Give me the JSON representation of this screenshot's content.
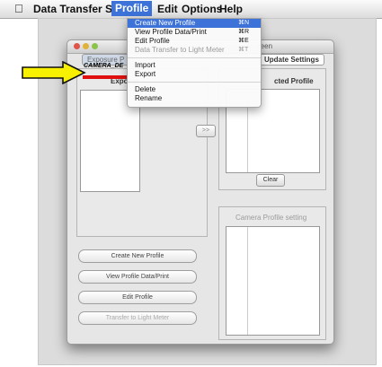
{
  "menubar": {
    "apple_icon": "apple-logo",
    "app_name": "Data Transfer Software",
    "menus": [
      "Profile",
      "Edit",
      "Options",
      "Help"
    ]
  },
  "dropdown": {
    "items": [
      {
        "label": "Create New Profile",
        "shortcut": "⌘N"
      },
      {
        "label": "View Profile Data/Print",
        "shortcut": "⌘R"
      },
      {
        "label": "Edit Profile",
        "shortcut": "⌘E"
      },
      {
        "label": "Data Transfer to Light Meter",
        "shortcut": "⌘T"
      },
      {
        "label": "Import",
        "shortcut": ""
      },
      {
        "label": "Export",
        "shortcut": ""
      },
      {
        "label": "Delete",
        "shortcut": ""
      },
      {
        "label": "Rename",
        "shortcut": ""
      }
    ]
  },
  "window": {
    "title_fragment": "reen",
    "tabs": [
      "Exposure P",
      "Update Settings"
    ],
    "exposure_label": "Exposur",
    "selected_label": "cted Profile",
    "camera_profile_label": "Camera Profile setting",
    "list_item": "CAMERA_DE",
    "move_button": ">>",
    "clear_button": "Clear",
    "buttons": [
      "Create New Profile",
      "View Profile Data/Print",
      "Edit Profile",
      "Transfer to Light Meter"
    ]
  },
  "colors": {
    "highlight": "#3d72d8",
    "arrow_fill": "#f7f000",
    "underline": "#e01010"
  }
}
